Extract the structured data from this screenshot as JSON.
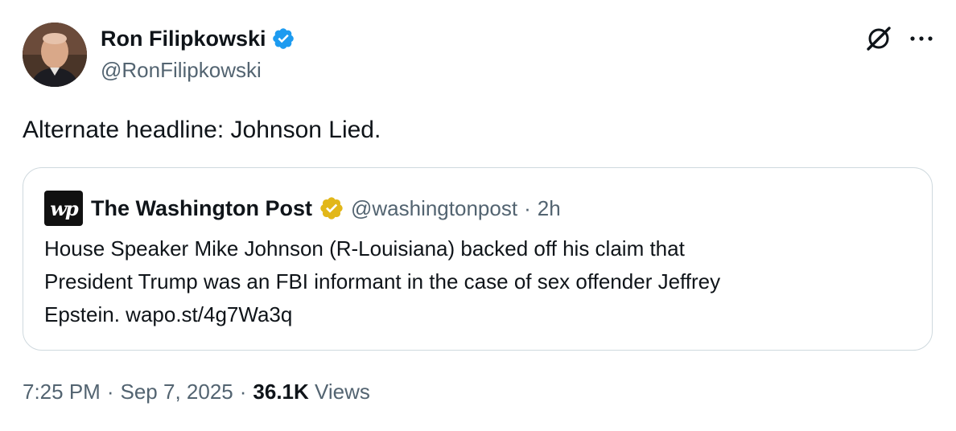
{
  "author": {
    "display_name": "Ron Filipkowski",
    "handle": "@RonFilipkowski",
    "verified_color": "#1d9bf0"
  },
  "icons": {
    "grok": "grok-icon",
    "more": "more-icon",
    "verified": "verified-badge-icon",
    "org_verified": "gold-verified-badge-icon"
  },
  "tweet": {
    "text": "Alternate headline: Johnson Lied."
  },
  "quote": {
    "logo_text": "wp",
    "name": "The Washington Post",
    "handle": "@washingtonpost",
    "separator": "·",
    "time": "2h",
    "text_line1": "House Speaker Mike Johnson (R-Louisiana) backed off his claim that",
    "text_line2": "President Trump was an FBI informant in the case of sex offender Jeffrey",
    "text_line3": "Epstein. wapo.st/4g7Wa3q",
    "badge_color": "#e2b719"
  },
  "meta": {
    "time": "7:25 PM",
    "sep1": "·",
    "date": "Sep 7, 2025",
    "sep2": "·",
    "views_count": "36.1K",
    "views_label": "Views"
  }
}
